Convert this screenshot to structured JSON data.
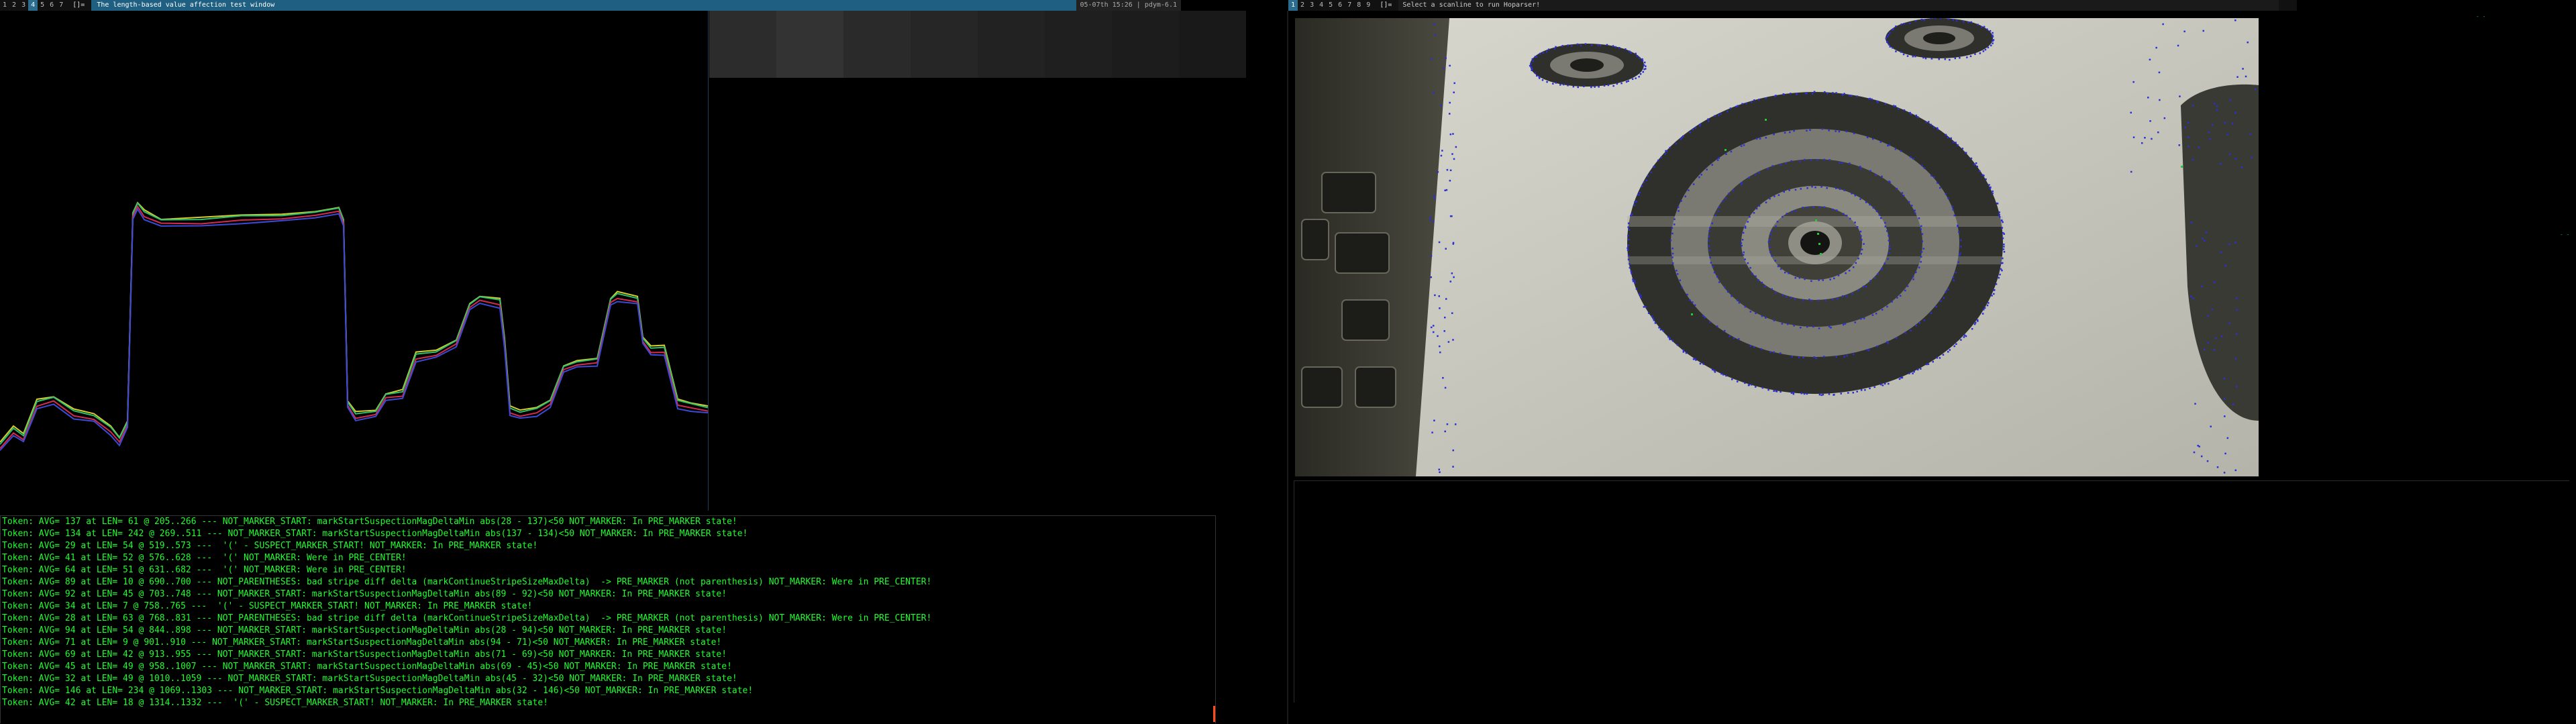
{
  "top_bar_left": {
    "workspaces": [
      "1",
      "2",
      "3",
      "4",
      "5",
      "6",
      "7"
    ],
    "active_workspace_index": 3,
    "layout_symbol": "[]=",
    "window_title": "The length-based value affection test window",
    "status": "05-07th 15:26 | pdym-6.1"
  },
  "top_bar_right": {
    "workspaces": [
      "1",
      "2",
      "3",
      "4",
      "5",
      "6",
      "7",
      "8",
      "9"
    ],
    "active_workspace_index": 0,
    "layout_symbol": "[]=",
    "window_title": "Select a scanline to run Hoparser!"
  },
  "plot": {
    "series_colors": [
      "#d5cd2d",
      "#2fbf6f",
      "#d32b4f",
      "#3b4bd8"
    ],
    "background": "#000000",
    "trace": [
      [
        0,
        663
      ],
      [
        20,
        640
      ],
      [
        35,
        650
      ],
      [
        55,
        600
      ],
      [
        80,
        595
      ],
      [
        110,
        615
      ],
      [
        140,
        620
      ],
      [
        165,
        640
      ],
      [
        178,
        656
      ],
      [
        190,
        630
      ],
      [
        198,
        320
      ],
      [
        205,
        305
      ],
      [
        215,
        318
      ],
      [
        240,
        330
      ],
      [
        300,
        328
      ],
      [
        360,
        325
      ],
      [
        420,
        322
      ],
      [
        470,
        318
      ],
      [
        505,
        312
      ],
      [
        512,
        330
      ],
      [
        518,
        600
      ],
      [
        530,
        618
      ],
      [
        560,
        614
      ],
      [
        575,
        590
      ],
      [
        600,
        585
      ],
      [
        620,
        530
      ],
      [
        650,
        525
      ],
      [
        680,
        510
      ],
      [
        700,
        455
      ],
      [
        715,
        445
      ],
      [
        745,
        450
      ],
      [
        752,
        510
      ],
      [
        760,
        610
      ],
      [
        775,
        615
      ],
      [
        800,
        612
      ],
      [
        820,
        600
      ],
      [
        840,
        548
      ],
      [
        860,
        540
      ],
      [
        890,
        538
      ],
      [
        910,
        448
      ],
      [
        920,
        440
      ],
      [
        950,
        445
      ],
      [
        958,
        505
      ],
      [
        970,
        520
      ],
      [
        990,
        520
      ],
      [
        1010,
        600
      ],
      [
        1030,
        605
      ],
      [
        1055,
        608
      ]
    ]
  },
  "gray_strip_colors": [
    "#2c2c2c",
    "#333333",
    "#2a2a2a",
    "#262626",
    "#222222",
    "#1f1f1f",
    "#1c1c1c",
    "#191919"
  ],
  "log": [
    "Token: AVG= 137 at LEN= 61 @ 205..266 --- NOT_MARKER_START: markStartSuspectionMagDeltaMin abs(28 - 137)<50 NOT_MARKER: In PRE_MARKER state!",
    "Token: AVG= 134 at LEN= 242 @ 269..511 --- NOT_MARKER_START: markStartSuspectionMagDeltaMin abs(137 - 134)<50 NOT_MARKER: In PRE_MARKER state!",
    "Token: AVG= 29 at LEN= 54 @ 519..573 ---  '(' - SUSPECT_MARKER_START! NOT_MARKER: In PRE_MARKER state!",
    "Token: AVG= 41 at LEN= 52 @ 576..628 ---  '(' NOT_MARKER: Were in PRE_CENTER!",
    "Token: AVG= 64 at LEN= 51 @ 631..682 ---  '(' NOT_MARKER: Were in PRE_CENTER!",
    "Token: AVG= 89 at LEN= 10 @ 690..700 --- NOT_PARENTHESES: bad stripe diff delta (markContinueStripeSizeMaxDelta)  -> PRE_MARKER (not parenthesis) NOT_MARKER: Were in PRE_CENTER!",
    "Token: AVG= 92 at LEN= 45 @ 703..748 --- NOT_MARKER_START: markStartSuspectionMagDeltaMin abs(89 - 92)<50 NOT_MARKER: In PRE_MARKER state!",
    "Token: AVG= 34 at LEN= 7 @ 758..765 ---  '(' - SUSPECT_MARKER_START! NOT_MARKER: In PRE_MARKER state!",
    "Token: AVG= 28 at LEN= 63 @ 768..831 --- NOT_PARENTHESES: bad stripe diff delta (markContinueStripeSizeMaxDelta)  -> PRE_MARKER (not parenthesis) NOT_MARKER: Were in PRE_CENTER!",
    "Token: AVG= 94 at LEN= 54 @ 844..898 --- NOT_MARKER_START: markStartSuspectionMagDeltaMin abs(28 - 94)<50 NOT_MARKER: In PRE_MARKER state!",
    "Token: AVG= 71 at LEN= 9 @ 901..910 --- NOT_MARKER_START: markStartSuspectionMagDeltaMin abs(94 - 71)<50 NOT_MARKER: In PRE_MARKER state!",
    "Token: AVG= 69 at LEN= 42 @ 913..955 --- NOT_MARKER_START: markStartSuspectionMagDeltaMin abs(71 - 69)<50 NOT_MARKER: In PRE_MARKER state!",
    "Token: AVG= 45 at LEN= 49 @ 958..1007 --- NOT_MARKER_START: markStartSuspectionMagDeltaMin abs(69 - 45)<50 NOT_MARKER: In PRE_MARKER state!",
    "Token: AVG= 32 at LEN= 49 @ 1010..1059 --- NOT_MARKER_START: markStartSuspectionMagDeltaMin abs(45 - 32)<50 NOT_MARKER: In PRE_MARKER state!",
    "Token: AVG= 146 at LEN= 234 @ 1069..1303 --- NOT_MARKER_START: markStartSuspectionMagDeltaMin abs(32 - 146)<50 NOT_MARKER: In PRE_MARKER state!",
    "Token: AVG= 42 at LEN= 18 @ 1314..1332 ---  '(' - SUSPECT_MARKER_START! NOT_MARKER: In PRE_MARKER state!"
  ],
  "camera": {
    "background": "#c6c6bd",
    "edge_point_color": "#2a2fd6",
    "center_point_color": "#22cc33"
  },
  "right_edge_marks": [
    "- -",
    "- -"
  ]
}
